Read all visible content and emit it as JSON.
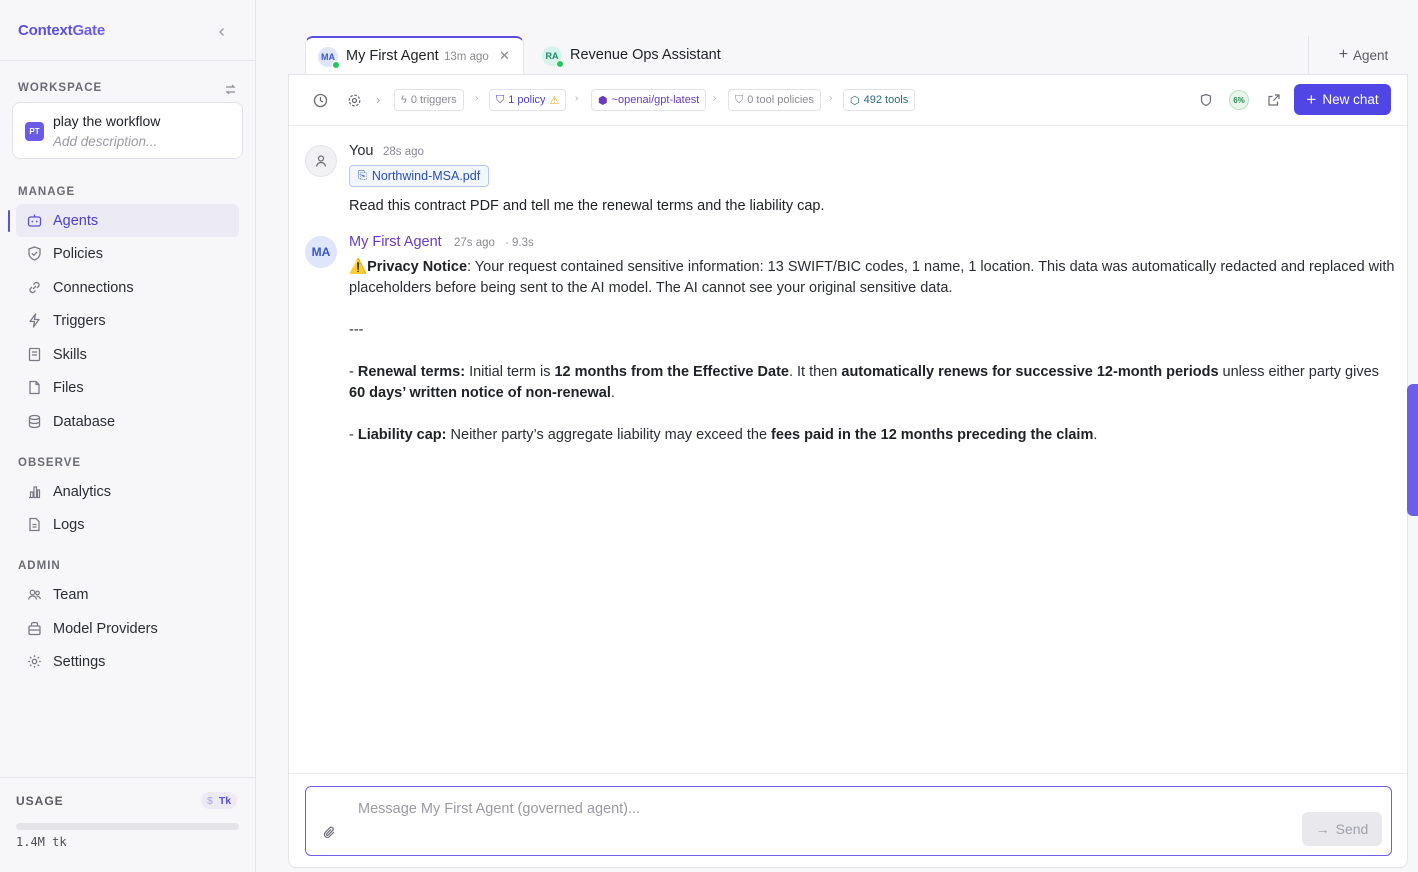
{
  "brand": {
    "part1": "Context",
    "part2": "Gate"
  },
  "sidebar": {
    "workspace_label": "WORKSPACE",
    "workspace": {
      "initials": "PT",
      "name": "play the workflow",
      "description_placeholder": "Add description..."
    },
    "sections": {
      "manage": "MANAGE",
      "observe": "OBSERVE",
      "admin": "ADMIN"
    },
    "items": [
      {
        "label": "Agents",
        "icon": "bot-icon",
        "active": true
      },
      {
        "label": "Policies",
        "icon": "shield-icon"
      },
      {
        "label": "Connections",
        "icon": "link-icon"
      },
      {
        "label": "Triggers",
        "icon": "bolt-icon"
      },
      {
        "label": "Skills",
        "icon": "book-icon"
      },
      {
        "label": "Files",
        "icon": "file-icon"
      },
      {
        "label": "Database",
        "icon": "database-icon"
      },
      {
        "label": "Analytics",
        "icon": "bar-chart-icon"
      },
      {
        "label": "Logs",
        "icon": "log-icon"
      },
      {
        "label": "Team",
        "icon": "users-icon"
      },
      {
        "label": "Model Providers",
        "icon": "box-icon"
      },
      {
        "label": "Settings",
        "icon": "gear-icon"
      }
    ],
    "usage": {
      "label": "USAGE",
      "toggle_dollar": "$",
      "toggle_tk": "Tk",
      "value": "1.4M tk",
      "fraction": 0.0
    }
  },
  "tabs": [
    {
      "initials": "MA",
      "title": "My First Agent",
      "time": "13m ago",
      "active": true
    },
    {
      "initials": "RA",
      "title": "Revenue Ops Assistant",
      "active": false
    }
  ],
  "agent_button": "Agent",
  "toolbar": {
    "triggers": "0 triggers",
    "policy": "1 policy",
    "policy_warning": "⚠",
    "model": "~openai/gpt-latest",
    "tool_policies": "0 tool policies",
    "tools": "492 tools",
    "percent": "6%",
    "new_chat": "New chat"
  },
  "messages": {
    "user": {
      "name": "You",
      "time": "28s ago",
      "attachment": "Northwind-MSA.pdf",
      "text": "Read this contract PDF and tell me the renewal terms and the liability cap."
    },
    "agent": {
      "initials": "MA",
      "name": "My First Agent",
      "time": "27s ago",
      "duration": "· 9.3s",
      "notice_icon": "⚠️",
      "notice_title": "Privacy Notice",
      "notice_text": ": Your request contained sensitive information: 13 SWIFT/BIC codes, 1 name, 1 location. This data was automatically redacted and replaced with placeholders before being sent to the AI model. The AI cannot see your original sensitive data.",
      "separator": "---",
      "renewal_dash": "- ",
      "renewal_label": "Renewal terms:",
      "renewal_text1": " Initial term is ",
      "renewal_bold1": "12 months from the Effective Date",
      "renewal_text2": ". It then ",
      "renewal_bold2": "automatically renews for successive 12-month periods",
      "renewal_text3": " unless either party gives ",
      "renewal_bold3": "60 days’ written notice of non-renewal",
      "renewal_text4": ".",
      "liability_dash": "- ",
      "liability_label": "Liability cap:",
      "liability_text1": " Neither party’s aggregate liability may exceed the ",
      "liability_bold": "fees paid in the 12 months preceding the claim",
      "liability_text2": "."
    }
  },
  "composer": {
    "placeholder": "Message My First Agent (governed agent)...",
    "send": "Send"
  },
  "colors": {
    "accent": "#4f46e5",
    "brand": "#5b4fe0",
    "online": "#22c55e"
  }
}
